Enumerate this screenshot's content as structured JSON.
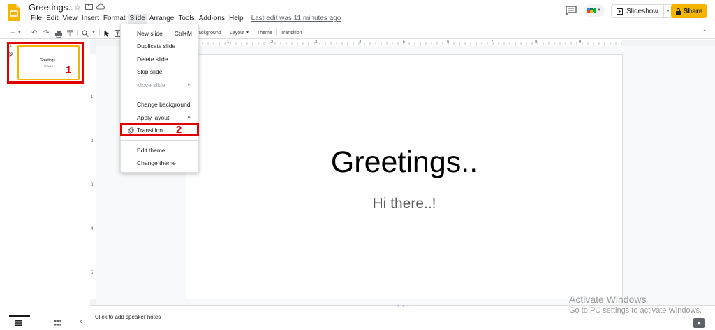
{
  "header": {
    "doc_title": "Greetings..",
    "last_edit": "Last edit was 11 minutes ago",
    "slideshow_label": "Slideshow",
    "share_label": "Share"
  },
  "menubar": {
    "items": [
      "File",
      "Edit",
      "View",
      "Insert",
      "Format",
      "Slide",
      "Arrange",
      "Tools",
      "Add-ons",
      "Help"
    ],
    "active": "Slide"
  },
  "toolbar": {
    "background_label": "ackground",
    "layout_label": "Layout",
    "theme_label": "Theme",
    "transition_label": "Transition"
  },
  "ruler": {
    "h_numbers": [
      "1",
      "2",
      "3",
      "4",
      "5",
      "6",
      "7",
      "8",
      "9"
    ],
    "v_numbers": [
      "1",
      "2",
      "3",
      "4",
      "5"
    ]
  },
  "slide_menu": {
    "new_slide": "New slide",
    "new_slide_shortcut": "Ctrl+M",
    "duplicate_slide": "Duplicate slide",
    "delete_slide": "Delete slide",
    "skip_slide": "Skip slide",
    "move_slide": "Move slide",
    "change_background": "Change background",
    "apply_layout": "Apply layout",
    "transition": "Transition",
    "edit_theme": "Edit theme",
    "change_theme": "Change theme"
  },
  "filmstrip": {
    "slide_number": "1",
    "thumb_title": "Greetings..",
    "thumb_subtitle": "Hi there..!"
  },
  "slide": {
    "title": "Greetings..",
    "subtitle": "Hi there..!"
  },
  "notes": {
    "placeholder": "Click to add speaker notes"
  },
  "annotations": {
    "step1": "1",
    "step2": "2"
  },
  "watermark": {
    "title": "Activate Windows",
    "subtitle": "Go to PC settings to activate Windows."
  },
  "colors": {
    "brand": "#f4b400",
    "annotation": "#e00000"
  }
}
